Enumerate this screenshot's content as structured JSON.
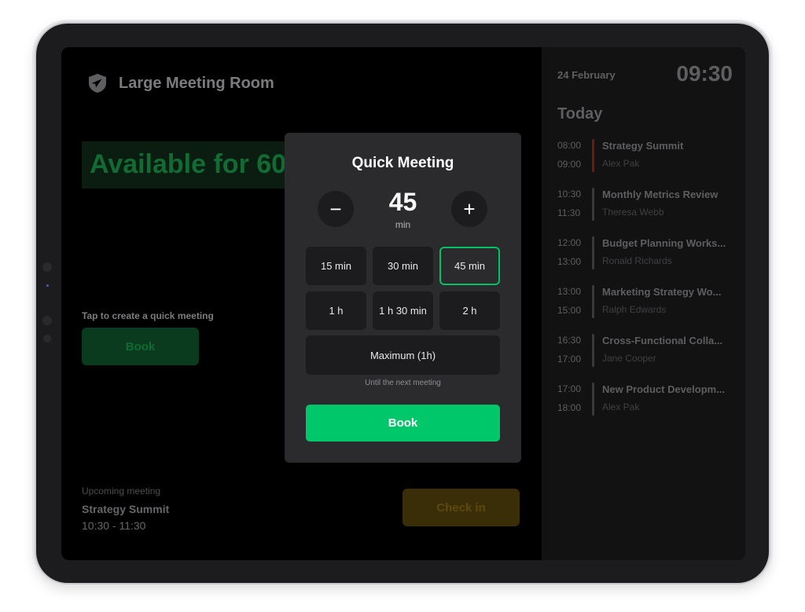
{
  "room": {
    "name": "Large Meeting Room",
    "icon": "location-arrow-shield-icon",
    "availability_text": "Available for 60 min"
  },
  "quick_create": {
    "hint": "Tap to create a quick meeting",
    "book_label": "Book"
  },
  "upcoming": {
    "label": "Upcoming meeting",
    "title": "Strategy Summit",
    "time": "10:30 - 11:30",
    "checkin_label": "Check in"
  },
  "schedule": {
    "date": "24 February",
    "clock": "09:30",
    "heading": "Today",
    "events": [
      {
        "start": "08:00",
        "end": "09:00",
        "title": "Strategy Summit",
        "person": "Alex Pak",
        "active": true
      },
      {
        "start": "10:30",
        "end": "11:30",
        "title": "Monthly Metrics Review",
        "person": "Theresa Webb",
        "active": false
      },
      {
        "start": "12:00",
        "end": "13:00",
        "title": "Budget Planning Works...",
        "person": "Ronald Richards",
        "active": false
      },
      {
        "start": "13:00",
        "end": "15:00",
        "title": "Marketing Strategy Wo...",
        "person": "Ralph Edwards",
        "active": false
      },
      {
        "start": "16:30",
        "end": "17:00",
        "title": "Cross-Functional Colla...",
        "person": "Jane Cooper",
        "active": false
      },
      {
        "start": "17:00",
        "end": "18:00",
        "title": "New Product Developm...",
        "person": "Alex Pak",
        "active": false
      }
    ]
  },
  "modal": {
    "title": "Quick Meeting",
    "minus_symbol": "−",
    "plus_symbol": "+",
    "duration_value": "45",
    "duration_unit": "min",
    "options": [
      "15 min",
      "30 min",
      "45 min",
      "1 h",
      "1 h 30 min",
      "2 h"
    ],
    "selected_option": "45 min",
    "maximum_label": "Maximum (1h)",
    "maximum_note": "Until the next meeting",
    "book_label": "Book"
  },
  "colors": {
    "accent_green": "#00c86a",
    "selected_border": "#00c264",
    "checkin_yellow": "#3a2e08",
    "active_event_bar": "#6e1a12"
  }
}
